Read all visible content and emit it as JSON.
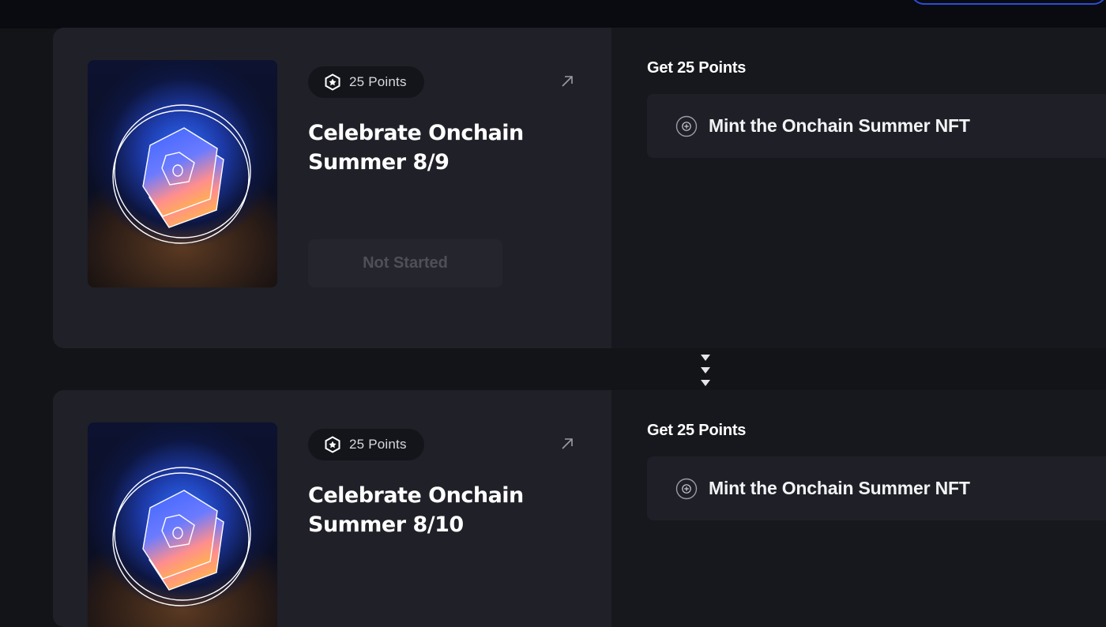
{
  "quests": [
    {
      "points_label": "25 Points",
      "title": "Celebrate Onchain Summer 8/9",
      "status_label": "Not Started",
      "reward_heading": "Get 25 Points",
      "task_label": "Mint the Onchain Summer NFT"
    },
    {
      "points_label": "25 Points",
      "title": "Celebrate Onchain Summer 8/10",
      "reward_heading": "Get 25 Points",
      "task_label": "Mint the Onchain Summer NFT"
    }
  ],
  "icons": {
    "points": "hexagon-star-icon",
    "external_link": "arrow-up-right-icon",
    "task": "plus-circle-icon",
    "connector": "chevron-down-icon"
  },
  "colors": {
    "background": "#131417",
    "card_left": "#1f2028",
    "card_right": "#17181d",
    "accent_blue": "#2a4dd6",
    "status_text": "#4e5059"
  }
}
